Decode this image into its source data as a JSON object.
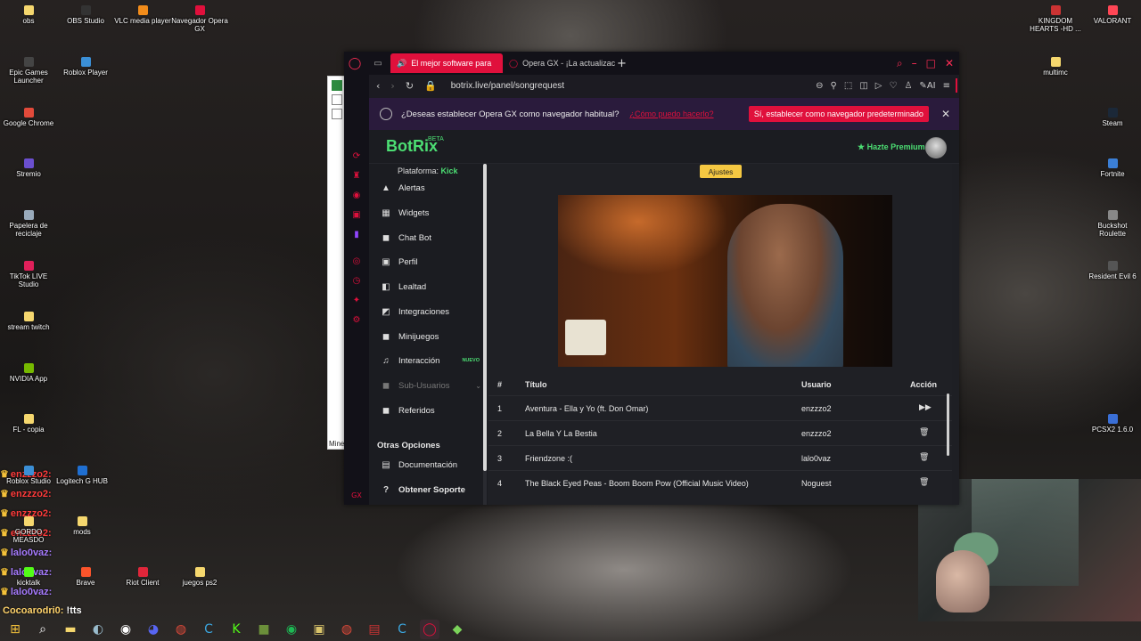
{
  "desktop": {
    "left_icons": [
      {
        "label": "obs",
        "color": "#f5d76e"
      },
      {
        "label": "Epic Games Launcher",
        "color": "#444"
      },
      {
        "label": "Google Chrome",
        "color": "#e24a3a"
      },
      {
        "label": "Stremio",
        "color": "#6b4fcf"
      },
      {
        "label": "Papelera de reciclaje",
        "color": "#9ab"
      },
      {
        "label": "TikTok LIVE Studio",
        "color": "#e0205a"
      },
      {
        "label": "stream twitch",
        "color": "#f5d76e"
      },
      {
        "label": "NVIDIA App",
        "color": "#76b900"
      },
      {
        "label": "FL - copia",
        "color": "#f5d76e"
      },
      {
        "label": "Roblox Studio",
        "color": "#3b8fd6"
      },
      {
        "label": "GORDO MEASDO",
        "color": "#f5d76e"
      },
      {
        "label": "kicktalk",
        "color": "#53fc18"
      }
    ],
    "col2_icons": [
      {
        "label": "OBS Studio",
        "color": "#333"
      },
      {
        "label": "Roblox Player",
        "color": "#3b8fd6"
      },
      {
        "label": "Logitech G HUB",
        "color": "#1f6fd1"
      },
      {
        "label": "mods",
        "color": "#f5d76e"
      },
      {
        "label": "Brave",
        "color": "#fb542b"
      }
    ],
    "col3_icons": [
      {
        "label": "VLC media player",
        "color": "#f28c1a"
      },
      {
        "label": "Riot Client",
        "color": "#e0263a"
      }
    ],
    "col4_icons": [
      {
        "label": "Navegador Opera GX",
        "color": "#e0103c"
      },
      {
        "label": "juegos ps2",
        "color": "#f5d76e"
      }
    ],
    "right_icons": [
      {
        "label": "KINGDOM HEARTS -HD ...",
        "color": "#c33"
      },
      {
        "label": "VALORANT",
        "color": "#ff4655"
      },
      {
        "label": "multimc",
        "color": "#f5d76e"
      },
      {
        "label": "Steam",
        "color": "#1b2838"
      },
      {
        "label": "Fortnite",
        "color": "#3b7fd6"
      },
      {
        "label": "Buckshot Roulette",
        "color": "#888"
      },
      {
        "label": "Resident Evil 6",
        "color": "#555"
      },
      {
        "label": "PCSX2 1.6.0",
        "color": "#3a6fd6"
      }
    ]
  },
  "chat": {
    "lines": [
      {
        "name": "enzzzo2:",
        "msg": "",
        "name_color": "red"
      },
      {
        "name": "enzzzo2:",
        "msg": "",
        "name_color": "red"
      },
      {
        "name": "enzzzo2:",
        "msg": "",
        "name_color": "red"
      },
      {
        "name": "enzzzo2:",
        "msg": "",
        "name_color": "red"
      },
      {
        "name": "lalo0vaz:",
        "msg": "",
        "name_color": "purple"
      },
      {
        "name": "lalo0vaz:",
        "msg": "",
        "name_color": "purple"
      },
      {
        "name": "lalo0vaz:",
        "msg": "",
        "name_color": "purple"
      }
    ],
    "last": {
      "name": "Cocoarodri0:",
      "msg": "!tts"
    }
  },
  "browser": {
    "tabs": [
      {
        "label": "El mejor software para"
      },
      {
        "label": "Opera GX - ¡La actualizació"
      }
    ],
    "url": "botrix.live/panel/songrequest",
    "notification": {
      "question": "¿Deseas establecer Opera GX como navegador habitual?",
      "howto": "¿Cómo puedo hacerlo?",
      "button": "Sí, establecer como navegador predeterminado"
    },
    "tools_ai": "AI"
  },
  "botrix": {
    "brand": "BotRix",
    "beta": "BETA",
    "premium": "Hazte Premium",
    "platform_label": "Plataforma:",
    "platform_value": "Kick",
    "nav": [
      {
        "label": "Alertas",
        "icon": "warning-icon"
      },
      {
        "label": "Widgets",
        "icon": "widgets-icon"
      },
      {
        "label": "Chat Bot",
        "icon": "chat-icon"
      },
      {
        "label": "Perfil",
        "icon": "profile-icon"
      },
      {
        "label": "Lealtad",
        "icon": "loyalty-icon"
      },
      {
        "label": "Integraciones",
        "icon": "integrations-icon"
      },
      {
        "label": "Minijuegos",
        "icon": "gamepad-icon"
      },
      {
        "label": "Interacción",
        "icon": "music-icon",
        "badge": "NUEVO"
      },
      {
        "label": "Sub-Usuarios",
        "icon": "users-icon",
        "disabled": true
      },
      {
        "label": "Referidos",
        "icon": "referrals-icon"
      }
    ],
    "other_options_title": "Otras Opciones",
    "other_nav": [
      {
        "label": "Documentación",
        "icon": "docs-icon"
      },
      {
        "label": "Obtener Soporte",
        "icon": "help-icon"
      }
    ],
    "ajustes": "Ajustes",
    "table": {
      "headers": {
        "num": "#",
        "title": "Título",
        "user": "Usuario",
        "action": "Acción"
      },
      "rows": [
        {
          "num": "1",
          "title": "Aventura - Ella y Yo (ft. Don Omar)",
          "user": "enzzzo2",
          "action": "skip"
        },
        {
          "num": "2",
          "title": "La Bella Y La Bestia",
          "user": "enzzzo2",
          "action": "delete"
        },
        {
          "num": "3",
          "title": "Friendzone :(",
          "user": "lalo0vaz",
          "action": "delete"
        },
        {
          "num": "4",
          "title": "The Black Eyed Peas - Boom Boom Pow (Official Music Video)",
          "user": "Noguest",
          "action": "delete"
        }
      ]
    }
  },
  "background_window": {
    "label": "Mine"
  }
}
